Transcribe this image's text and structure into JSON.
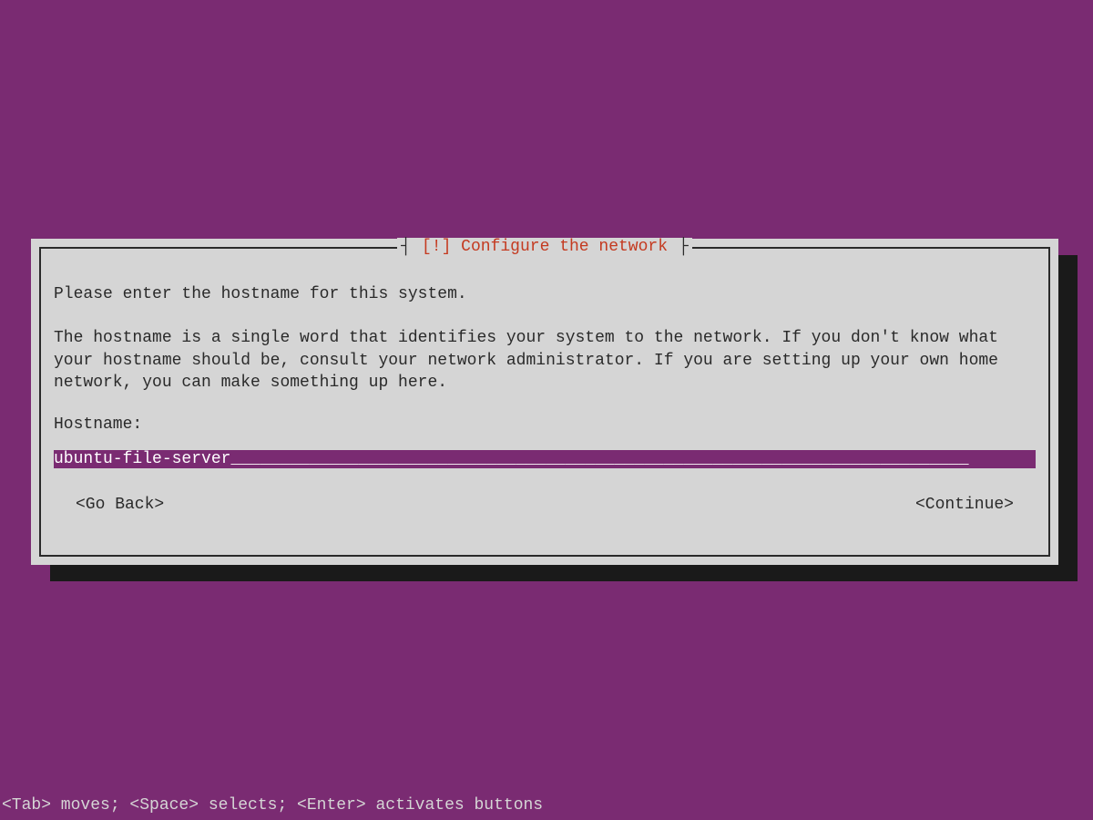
{
  "dialog": {
    "title_bracket_left": "┤",
    "title_bracket_right": "├",
    "title": "[!] Configure the network",
    "intro": "Please enter the hostname for this system.",
    "description": "The hostname is a single word that identifies your system to the network. If you don't know what your hostname should be, consult your network administrator. If you are setting up your own home network, you can make something up here.",
    "field_label": "Hostname:",
    "field_value": "ubuntu-file-server",
    "field_fill": "___________________________________________________________________________",
    "buttons": {
      "back": "<Go Back>",
      "continue": "<Continue>"
    }
  },
  "statusbar": "<Tab> moves; <Space> selects; <Enter> activates buttons"
}
